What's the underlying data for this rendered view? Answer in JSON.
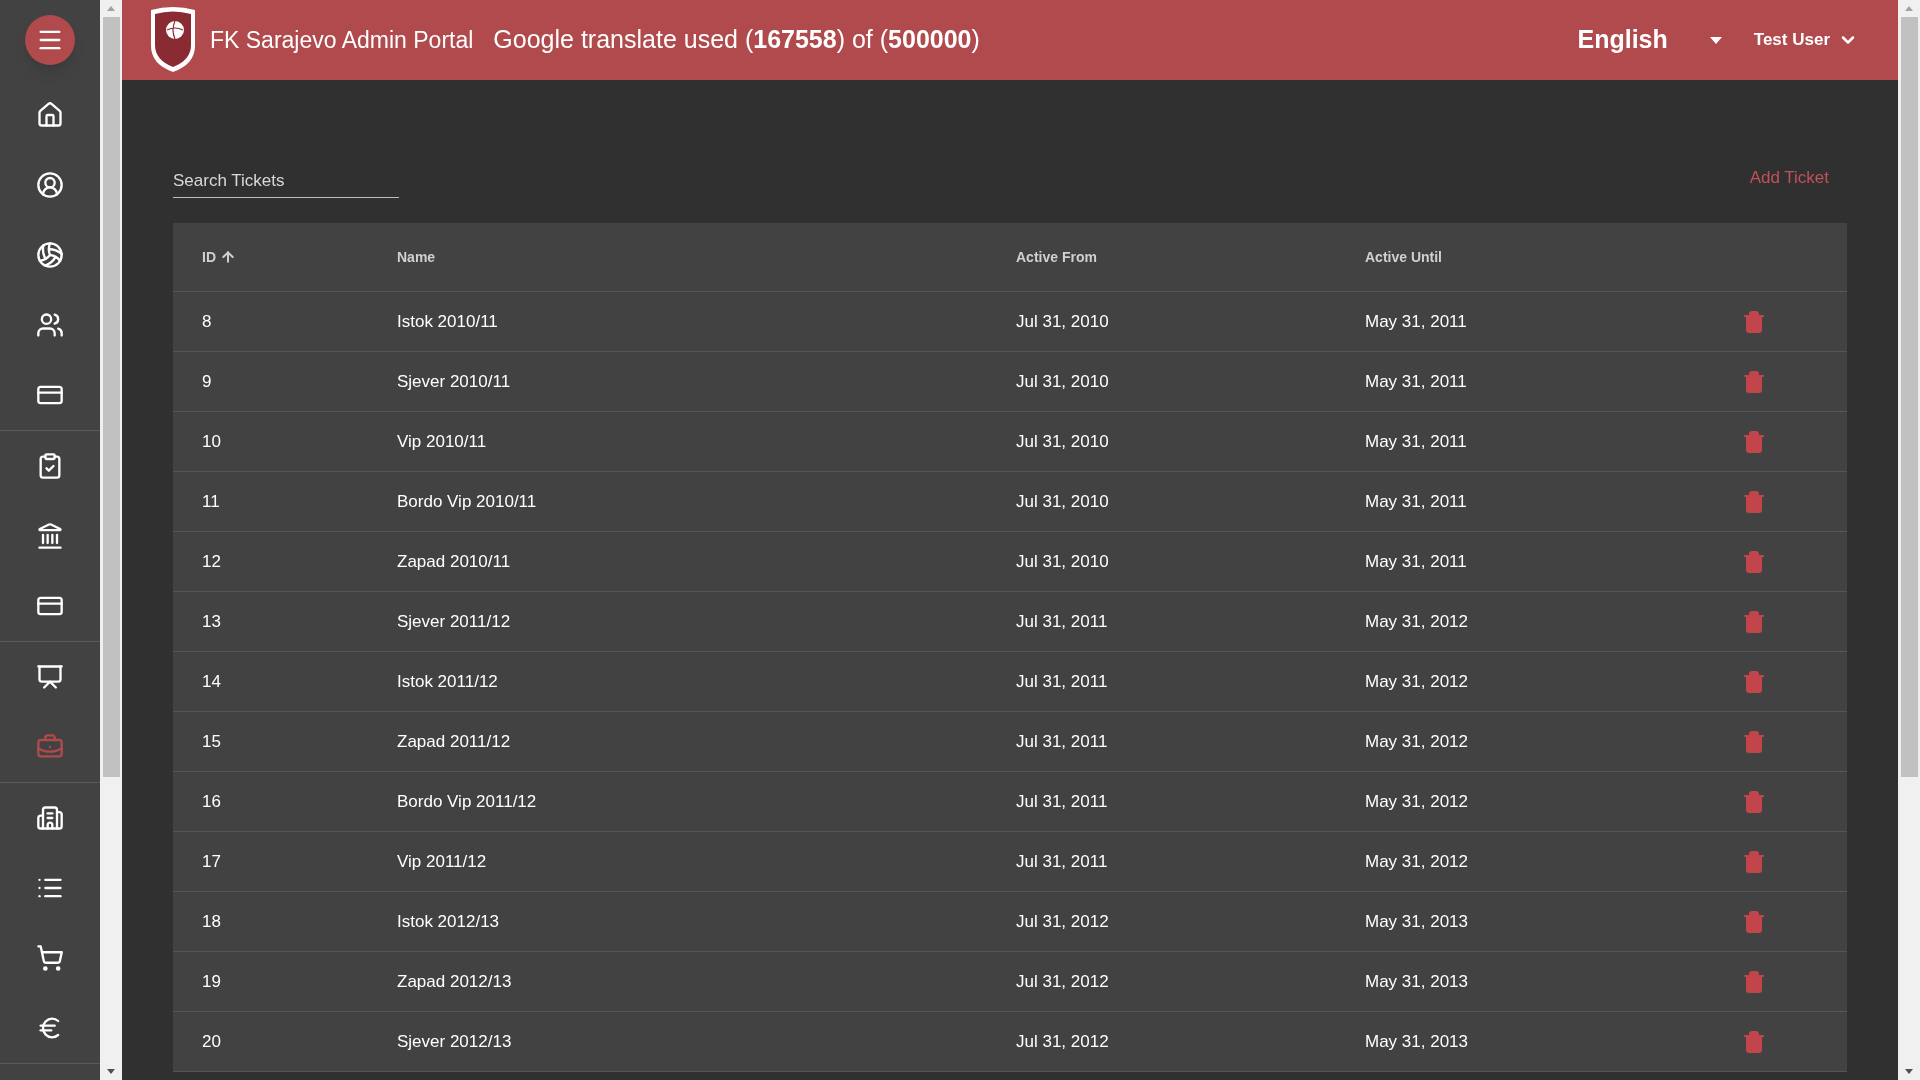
{
  "header": {
    "title": "FK Sarajevo Admin Portal",
    "translate_usage": "Google translate used (**167558**) of (**500000**)",
    "language": "English",
    "user": "Test User"
  },
  "sidebar": {
    "items": [
      {
        "kind": "home",
        "selected": false
      },
      {
        "kind": "account",
        "selected": false
      },
      {
        "kind": "ball",
        "selected": false
      },
      {
        "kind": "people",
        "selected": false
      },
      {
        "kind": "card",
        "selected": false,
        "divider": true
      },
      {
        "kind": "clipboard",
        "selected": false
      },
      {
        "kind": "bank",
        "selected": false
      },
      {
        "kind": "card",
        "selected": false,
        "divider": true
      },
      {
        "kind": "certificate",
        "selected": false
      },
      {
        "kind": "briefcase",
        "selected": true,
        "divider": true
      },
      {
        "kind": "building",
        "selected": false
      },
      {
        "kind": "list",
        "selected": false
      },
      {
        "kind": "cart",
        "selected": false
      },
      {
        "kind": "euro",
        "selected": false,
        "divider": true
      }
    ]
  },
  "search": {
    "placeholder": "Search Tickets"
  },
  "add_button": "Add Ticket",
  "table": {
    "columns": [
      "ID",
      "Name",
      "Active From",
      "Active Until"
    ],
    "rows": [
      [
        "8",
        "Istok 2010/11",
        "Jul 31, 2010",
        "May 31, 2011"
      ],
      [
        "9",
        "Sjever 2010/11",
        "Jul 31, 2010",
        "May 31, 2011"
      ],
      [
        "10",
        "Vip 2010/11",
        "Jul 31, 2010",
        "May 31, 2011"
      ],
      [
        "11",
        "Bordo Vip 2010/11",
        "Jul 31, 2010",
        "May 31, 2011"
      ],
      [
        "12",
        "Zapad 2010/11",
        "Jul 31, 2010",
        "May 31, 2011"
      ],
      [
        "13",
        "Sjever 2011/12",
        "Jul 31, 2011",
        "May 31, 2012"
      ],
      [
        "14",
        "Istok 2011/12",
        "Jul 31, 2011",
        "May 31, 2012"
      ],
      [
        "15",
        "Zapad 2011/12",
        "Jul 31, 2011",
        "May 31, 2012"
      ],
      [
        "16",
        "Bordo Vip 2011/12",
        "Jul 31, 2011",
        "May 31, 2012"
      ],
      [
        "17",
        "Vip 2011/12",
        "Jul 31, 2011",
        "May 31, 2012"
      ],
      [
        "18",
        "Istok 2012/13",
        "Jul 31, 2012",
        "May 31, 2013"
      ],
      [
        "19",
        "Zapad 2012/13",
        "Jul 31, 2012",
        "May 31, 2013"
      ],
      [
        "20",
        "Sjever 2012/13",
        "Jul 31, 2012",
        "May 31, 2013"
      ]
    ]
  }
}
